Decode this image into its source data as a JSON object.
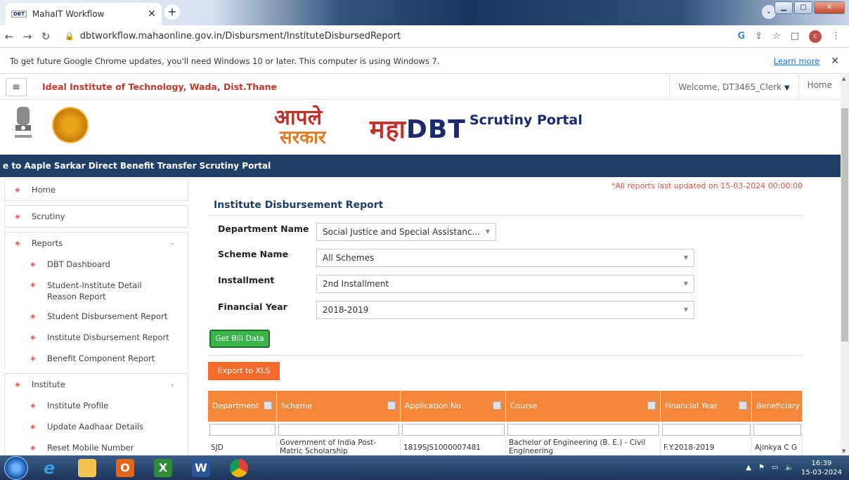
{
  "browser": {
    "tab_favicon": "DBT",
    "tab_title": "MahaIT Workflow",
    "url": "dbtworkflow.mahaonline.gov.in/Disbursment/InstituteDisbursedReport",
    "profile_initial": "c"
  },
  "infobar": {
    "message": "To get future Google Chrome updates, you'll need Windows 10 or later. This computer is using Windows 7.",
    "learn_more": "Learn more"
  },
  "header": {
    "institute": "Ideal Institute of Technology, Wada, Dist.Thane",
    "welcome": "Welcome, DT3465_Clerk",
    "home": "Home"
  },
  "banner": {
    "apale_line1": "आपले",
    "apale_line2": "सरकार",
    "maha": "महा",
    "dbt": "DBT",
    "portal": "Scrutiny Portal"
  },
  "marquee": "e to Aaple Sarkar Direct Benefit Transfer Scrutiny Portal",
  "sidebar": {
    "home": "Home",
    "scrutiny": "Scrutiny",
    "reports": "Reports",
    "report_items": [
      "DBT Dashboard",
      "Student-Institute Detail Reason Report",
      "Student Disbursement Report",
      "Institute Disbursement Report",
      "Benefit Component Report"
    ],
    "institute": "Institute",
    "institute_items": [
      "Institute Profile",
      "Update Aadhaar Details",
      "Reset Mobile Number"
    ]
  },
  "report": {
    "note": "*All reports last updated on 15-03-2024 00:00:00",
    "title": "Institute Disbursement Report",
    "department_label": "Department Name",
    "department_value": "Social Justice and Special Assistanc...",
    "scheme_label": "Scheme Name",
    "scheme_value": "All Schemes",
    "installment_label": "Installment",
    "installment_value": "2nd Installment",
    "fy_label": "Financial Year",
    "fy_value": "2018-2019",
    "get_bill": "Get Bill Data",
    "export": "Export to XLS"
  },
  "table": {
    "headers": [
      "Department",
      "Scheme",
      "Application No",
      "Course",
      "Financial Year",
      "Beneficiary"
    ],
    "rows": [
      [
        "SJD",
        "Government of India Post-Matric Scholarship",
        "1819SJS1000007481",
        "Bachelor of Engineering (B. E.) - Civil Engineering",
        "F.Y.2018-2019",
        "Ajinkya C G"
      ]
    ]
  },
  "taskbar": {
    "time": "16:39",
    "date": "15-03-2024"
  },
  "colors": {
    "brand_navy": "#213e66",
    "accent_red": "#c0392b",
    "table_header_orange": "#f5873b",
    "export_orange": "#f46b2b",
    "get_bill_green": "#3bb54a"
  }
}
